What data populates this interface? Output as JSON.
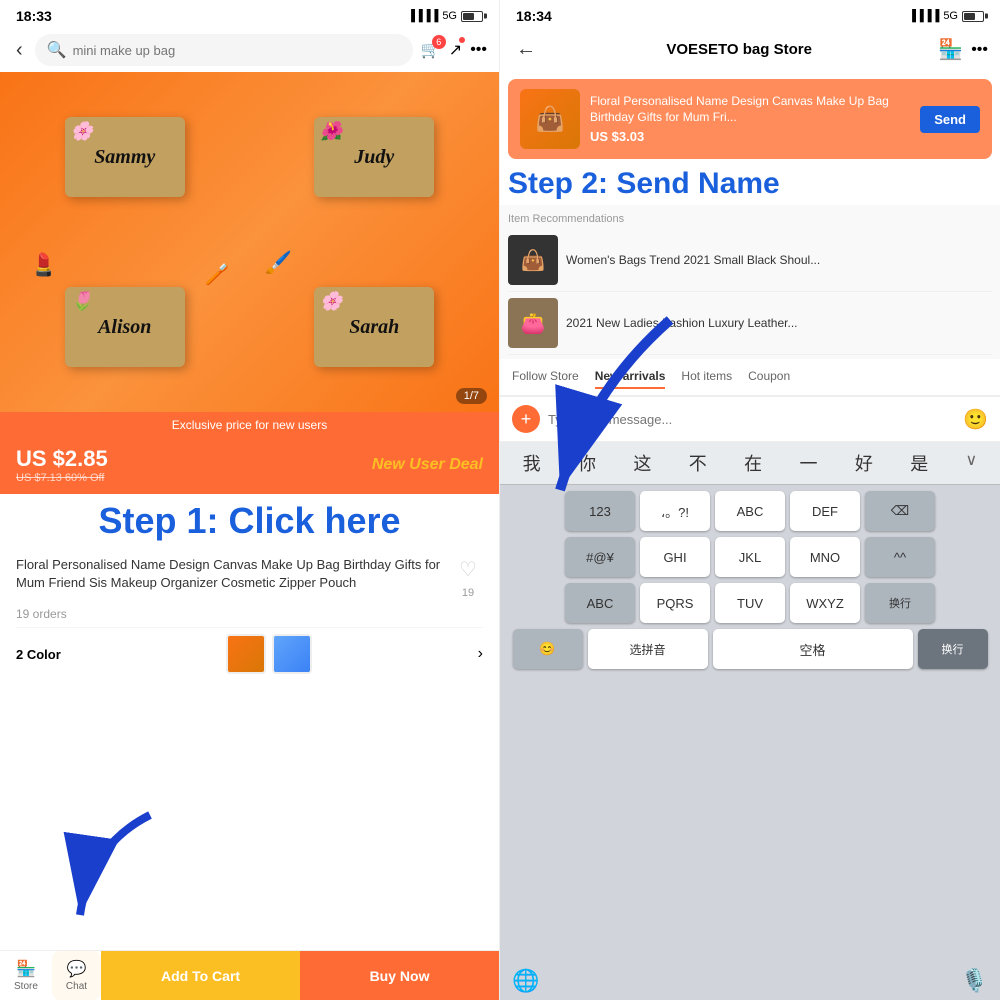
{
  "left": {
    "statusBar": {
      "time": "18:33",
      "signal": "5G"
    },
    "search": {
      "placeholder": "mini make up bag",
      "cartBadge": "6"
    },
    "productImage": {
      "names": [
        "Sammy",
        "Judy",
        "Alison",
        "Sarah"
      ],
      "counter": "1/7"
    },
    "exclusiveBanner": "Exclusive price for new users",
    "price": {
      "current": "US $2.85",
      "original": "US $7.13 60% Off",
      "deal": "New User Deal"
    },
    "step1": "Step 1: Click here",
    "productTitle": "Floral Personalised Name Design Canvas Make Up Bag Birthday Gifts for Mum Friend Sis Makeup Organizer Cosmetic Zipper Pouch",
    "favCount": "19",
    "ordersCount": "19 orders",
    "colorLabel": "2 Color",
    "bottomBar": {
      "storeLabel": "Store",
      "chatLabel": "Chat",
      "addToCart": "Add To Cart",
      "buyNow": "Buy Now"
    }
  },
  "right": {
    "statusBar": {
      "time": "18:34",
      "signal": "5G"
    },
    "storeTitle": "VOESETO bag Store",
    "productCard": {
      "title": "Floral Personalised Name Design Canvas Make Up Bag Birthday Gifts for Mum Fri...",
      "price": "US $3.03",
      "sendBtn": "Send"
    },
    "step2": "Step 2: Send Name",
    "recommendationsTitle": "Item Recommendations",
    "recommendations": [
      {
        "title": "Women's Bags Trend 2021 Small Black Shoul...",
        "emoji": "👜"
      },
      {
        "title": "2021 New Ladies Fashion Luxury Leather...",
        "emoji": "👛"
      }
    ],
    "chatTabs": [
      "Follow Store",
      "New arrivals",
      "Hot items",
      "Coupon"
    ],
    "messagePlaceholder": "Type your message...",
    "keyboard": {
      "quickChars": [
        "我",
        "你",
        "这",
        "不",
        "在",
        "一",
        "好",
        "是"
      ],
      "rows": [
        [
          "123",
          "،。?!",
          "ABC",
          "DEF",
          "⌫"
        ],
        [
          "#@¥",
          "GHI",
          "JKL",
          "MNO",
          "^^"
        ],
        [
          "ABC",
          "PQRS",
          "TUV",
          "WXYZ",
          "换行"
        ],
        [
          "😊",
          "选拼音",
          "空格",
          ""
        ]
      ]
    }
  }
}
